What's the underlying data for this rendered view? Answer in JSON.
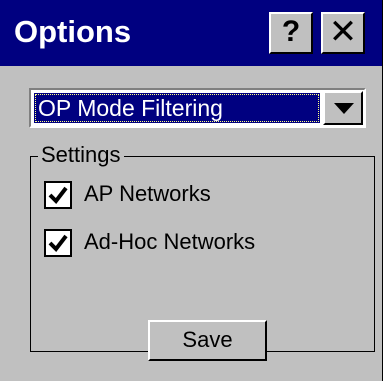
{
  "window": {
    "title": "Options",
    "help_label": "?",
    "close_label": "✕"
  },
  "combo": {
    "selected_value": "OP Mode Filtering",
    "arrow_icon": "chevron-down-icon"
  },
  "settings": {
    "legend": "Settings",
    "items": [
      {
        "label": "AP Networks",
        "checked": true
      },
      {
        "label": "Ad-Hoc Networks",
        "checked": true
      }
    ]
  },
  "actions": {
    "save_label": "Save"
  },
  "colors": {
    "title_bar": "#000080",
    "face": "#c0c0c0",
    "selection": "#000080"
  }
}
